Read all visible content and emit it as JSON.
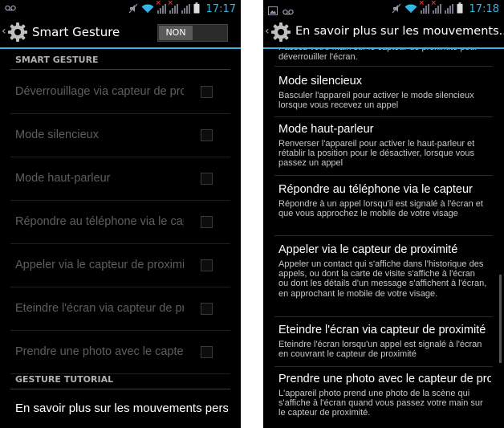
{
  "left": {
    "status": {
      "time": "17:17"
    },
    "title": "Smart Gesture",
    "switch_label": "NON",
    "section1": "SMART GESTURE",
    "items": [
      "Déverrouillage via capteur de proximité",
      "Mode silencieux",
      "Mode haut-parleur",
      "Répondre au téléphone via le capteur",
      "Appeler via le capteur de proximité",
      "Eteindre l'écran via capteur de proximité",
      "Prendre une photo avec le capteur"
    ],
    "section2": "GESTURE TUTORIAL",
    "tutorial_link": "En savoir plus sur les mouvements personnalisés"
  },
  "right": {
    "status": {
      "time": "17:18"
    },
    "title": "En savoir plus sur les mouvements...",
    "partial_top": "Passez votre main sur le capteur de proximité pour déverrouiller l'écran.",
    "items": [
      {
        "title": "Mode silencieux",
        "desc": "Basculer l'appareil pour activer le mode silencieux lorsque vous recevez un appel"
      },
      {
        "title": "Mode haut-parleur",
        "desc": "Renverser l'appareil pour activer le haut-parleur et rétablir la position pour le désactiver, lorsque vous passez un appel"
      },
      {
        "title": "Répondre au téléphone via le capteur",
        "desc": "Répondre à un appel lorsqu'il est signalé à l'écran et que vous approchez le mobile de votre visage"
      },
      {
        "title": "Appeler via le capteur de proximité",
        "desc": "Appeler un contact qui s'affiche dans l'historique des appels, ou dont la carte de visite s'affiche à l'écran ou dont les détails d'un message s'affichent à l'écran, en approchant le mobile de votre visage."
      },
      {
        "title": "Eteindre l'écran via capteur de proximité",
        "desc": "Eteindre l'écran lorsqu'un appel est signalé à l'écran en couvrant le capteur de proximité"
      },
      {
        "title": "Prendre une photo avec le capteur de proximité",
        "desc": "L'appareil photo prend une photo de la scène qui s'affiche à l'écran quand vous passez votre main sur le capteur de proximité."
      }
    ]
  },
  "icons": {
    "notify": "notification-icon",
    "voicemail": "voicemail-icon",
    "mute": "mute-icon",
    "wifi": "wifi-icon",
    "signal": "signal-icon",
    "battery": "battery-icon",
    "settings": "gear-icon",
    "up": "back-caret-icon"
  },
  "colors": {
    "accent": "#33b5e5",
    "background": "#000000"
  }
}
